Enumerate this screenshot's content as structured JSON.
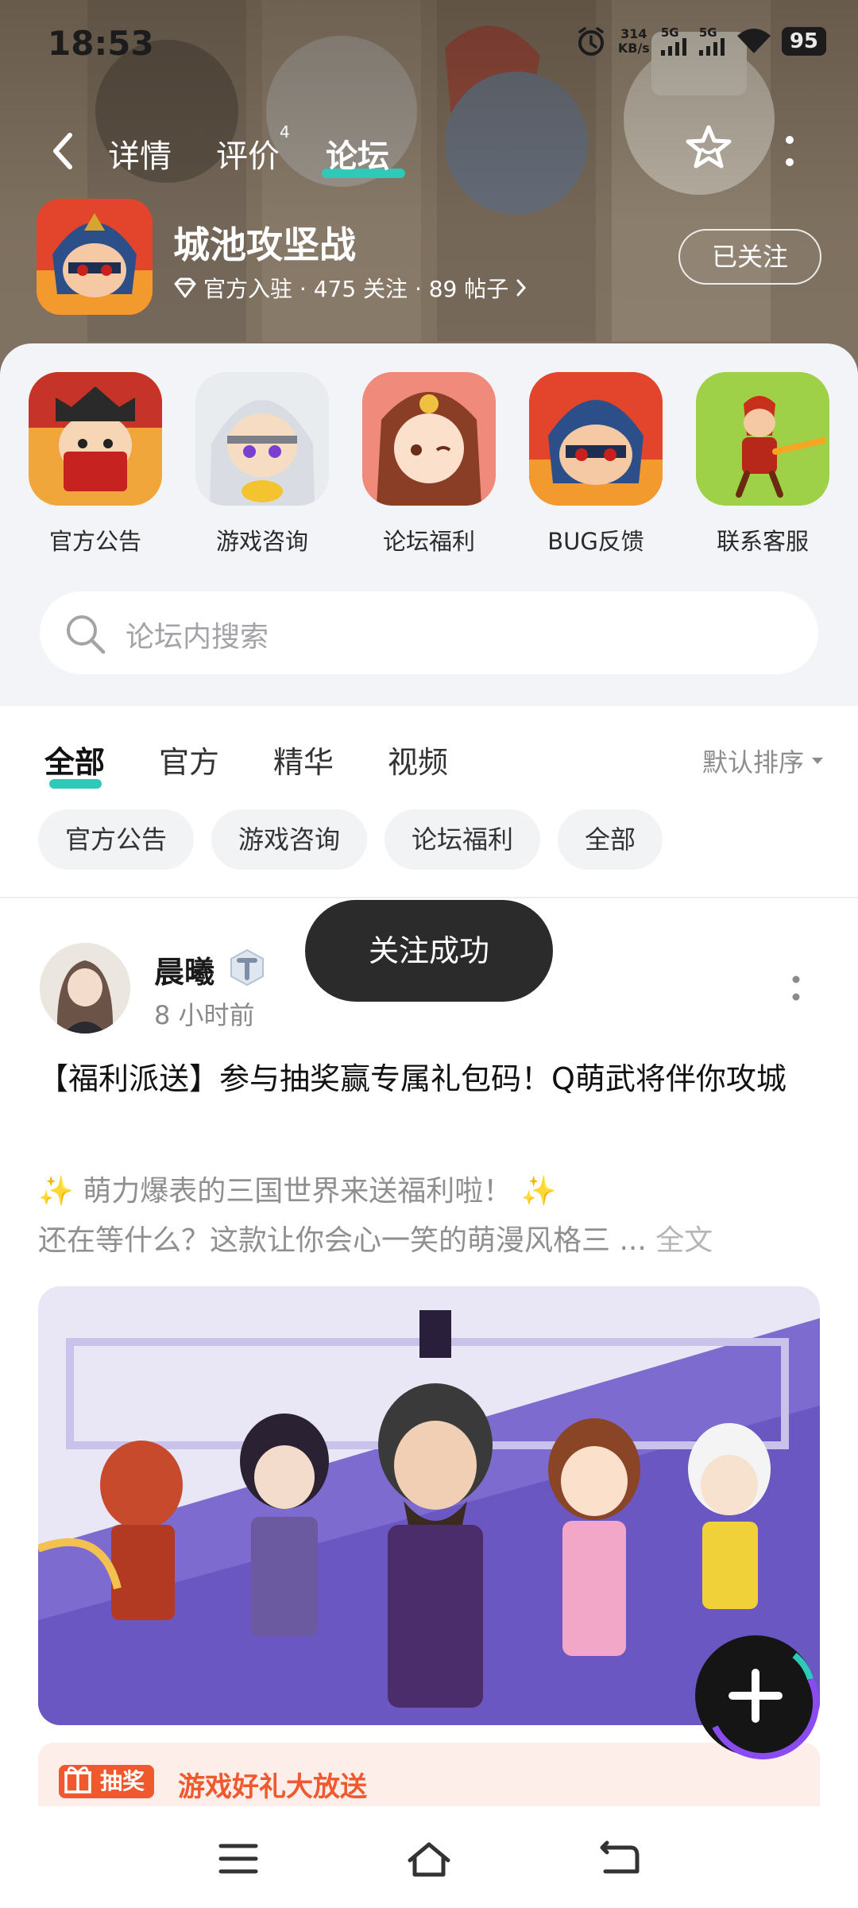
{
  "status_bar": {
    "time": "18:53",
    "net_speed_value": "314",
    "net_speed_unit": "KB/s",
    "signal1_label": "5G",
    "signal2_label": "5G",
    "battery": "95"
  },
  "nav": {
    "tabs": [
      {
        "label": "详情"
      },
      {
        "label": "评价",
        "badge": "4"
      },
      {
        "label": "论坛"
      }
    ],
    "active_tab": "论坛",
    "accent_color": "#2ec9b8"
  },
  "game": {
    "title": "城池攻坚战",
    "meta": "官方入驻 · 475 关注 · 89 帖子",
    "follow_label": "已关注"
  },
  "quick_links": [
    {
      "label": "官方公告"
    },
    {
      "label": "游戏咨询"
    },
    {
      "label": "论坛福利"
    },
    {
      "label": "BUG反馈"
    },
    {
      "label": "联系客服"
    }
  ],
  "search": {
    "placeholder": "论坛内搜索"
  },
  "category_tabs": [
    {
      "label": "全部"
    },
    {
      "label": "官方"
    },
    {
      "label": "精华"
    },
    {
      "label": "视频"
    }
  ],
  "active_category": "全部",
  "sort_label": "默认排序",
  "filter_chips": [
    {
      "label": "官方公告"
    },
    {
      "label": "游戏咨询"
    },
    {
      "label": "论坛福利"
    },
    {
      "label": "全部"
    }
  ],
  "post": {
    "author": "晨曦",
    "time": "8 小时前",
    "title": "【福利派送】参与抽奖赢专属礼包码！Q萌武将伴你攻城",
    "excerpt_line1": "✨ 萌力爆表的三国世界来送福利啦！ ✨",
    "excerpt_line2": "还在等什么？这款让你会心一笑的萌漫风格三 ...",
    "full_text_link": "全文",
    "promo_tag": "抽奖",
    "promo_text": "游戏好礼大放送"
  },
  "toast": "关注成功"
}
